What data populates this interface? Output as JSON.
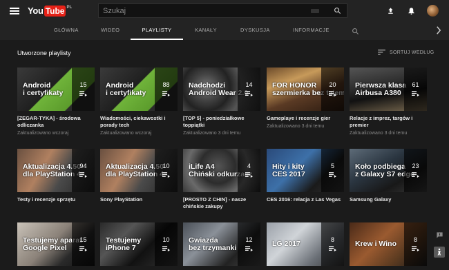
{
  "header": {
    "logo_you": "You",
    "logo_tube": "Tube",
    "logo_country": "PL",
    "search_placeholder": "Szukaj"
  },
  "tabs": [
    {
      "label": "GŁÓWNA"
    },
    {
      "label": "WIDEO"
    },
    {
      "label": "PLAYLISTY",
      "active": true
    },
    {
      "label": "KANAŁY"
    },
    {
      "label": "DYSKUSJA"
    },
    {
      "label": "INFORMACJE"
    }
  ],
  "section": {
    "title": "Utworzone playlisty",
    "sort_label": "SORTUJ WEDŁUG"
  },
  "playlists": [
    {
      "count": "15",
      "thumb_line1": "Android",
      "thumb_line2": "i certyfikaty",
      "title": "[ZEGAR-TYKA] - środowa odliczanka",
      "meta": "Zaktualizowano wczoraj"
    },
    {
      "count": "88",
      "thumb_line1": "Android",
      "thumb_line2": "i certyfikaty",
      "title": "Wiadomości, ciekawostki i porady tech",
      "meta": "Zaktualizowano wczoraj"
    },
    {
      "count": "14",
      "thumb_line1": "Nadchodzi",
      "thumb_line2": "Android Wear 2.0",
      "title": "[TOP 5] - poniedziałkowe toppiątki",
      "meta": "Zaktualizowano 3 dni temu"
    },
    {
      "count": "20",
      "thumb_line1": "FOR HONOR",
      "thumb_line2": "szermierka bez tajemnic",
      "title": "Gameplaye i recenzje gier",
      "meta": "Zaktualizowano 3 dni temu"
    },
    {
      "count": "61",
      "thumb_line1": "Pierwsza klasa",
      "thumb_line2": "Airbusa A380",
      "title": "Relacje z imprez, targów i premier",
      "meta": "Zaktualizowano 3 dni temu"
    },
    {
      "count": "94",
      "thumb_line1": "Aktualizacja 4.50",
      "thumb_line2": "dla PlayStation 4",
      "title": "Testy i recenzje sprzętu",
      "meta": ""
    },
    {
      "count": "10",
      "thumb_line1": "Aktualizacja 4.50",
      "thumb_line2": "dla PlayStation 4",
      "title": "Sony PlayStation",
      "meta": ""
    },
    {
      "count": "4",
      "thumb_line1": "iLife A4",
      "thumb_line2": "Chiński odkurzacz",
      "title": "[PROSTO Z CHIN] - nasze chińskie zakupy",
      "meta": ""
    },
    {
      "count": "5",
      "thumb_line1": "Hity i kity",
      "thumb_line2": "CES 2017",
      "title": "CES 2016: relacja z Las Vegas",
      "meta": ""
    },
    {
      "count": "23",
      "thumb_line1": "Koło podbiega",
      "thumb_line2": "z Galaxy S7 edge",
      "title": "Samsung Galaxy",
      "meta": ""
    },
    {
      "count": "15",
      "thumb_line1": "Testujemy aparat",
      "thumb_line2": "Google Pixel",
      "title": "",
      "meta": ""
    },
    {
      "count": "10",
      "thumb_line1": "Testujemy",
      "thumb_line2": "iPhone 7",
      "title": "",
      "meta": ""
    },
    {
      "count": "12",
      "thumb_line1": "Gwiazda",
      "thumb_line2": "bez trzymanki",
      "title": "",
      "meta": ""
    },
    {
      "count": "8",
      "thumb_line1": "LG 2017",
      "thumb_line2": "",
      "title": "",
      "meta": ""
    },
    {
      "count": "8",
      "thumb_line1": "Krew i Wino",
      "thumb_line2": "",
      "title": "",
      "meta": ""
    }
  ]
}
